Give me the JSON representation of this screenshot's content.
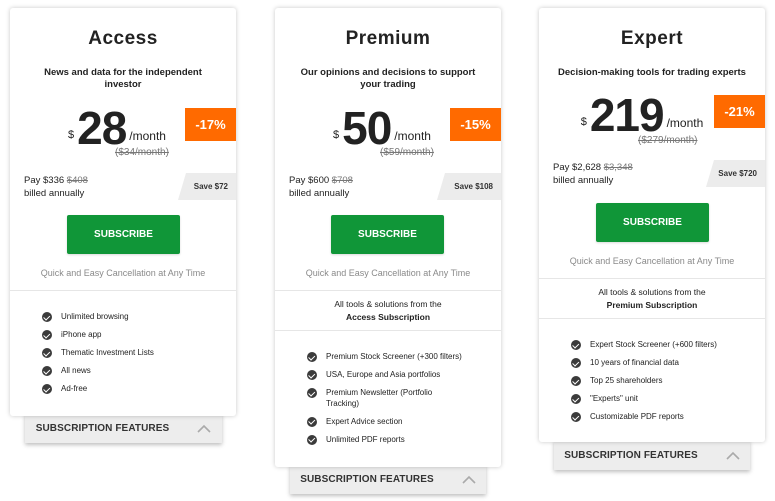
{
  "plans": [
    {
      "title": "Access",
      "description": "News and data for the independent investor",
      "currency": "$",
      "price": "28",
      "per": "/month",
      "old_price": "($34/month)",
      "discount": "-17%",
      "pay_prefix": "Pay $336",
      "pay_old": "$408",
      "billed": "billed annually",
      "save": "Save $72",
      "button": "SUBSCRIBE",
      "cancellation": "Quick and Easy Cancellation at Any Time",
      "features": [
        "Unlimited browsing",
        "iPhone app",
        "Thematic Investment Lists",
        "All news",
        "Ad-free"
      ],
      "tab": "SUBSCRIPTION FEATURES"
    },
    {
      "title": "Premium",
      "description": "Our opinions and decisions to support your trading",
      "currency": "$",
      "price": "50",
      "per": "/month",
      "old_price": "($59/month)",
      "discount": "-15%",
      "pay_prefix": "Pay $600",
      "pay_old": "$708",
      "billed": "billed annually",
      "save": "Save $108",
      "button": "SUBSCRIBE",
      "cancellation": "Quick and Easy Cancellation at Any Time",
      "note_line1": "All tools & solutions from the",
      "note_line2": "Access Subscription",
      "features": [
        "Premium Stock Screener (+300 filters)",
        "USA, Europe and Asia portfolios",
        "Premium Newsletter (Portfolio Tracking)",
        "Expert Advice section",
        "Unlimited PDF reports"
      ],
      "tab": "SUBSCRIPTION FEATURES"
    },
    {
      "title": "Expert",
      "description": "Decision-making tools for trading experts",
      "currency": "$",
      "price": "219",
      "per": "/month",
      "old_price": "($279/month)",
      "discount": "-21%",
      "pay_prefix": "Pay $2,628",
      "pay_old": "$3,348",
      "billed": "billed annually",
      "save": "Save $720",
      "button": "SUBSCRIBE",
      "cancellation": "Quick and Easy Cancellation at Any Time",
      "note_line1": "All tools & solutions from the",
      "note_line2": "Premium Subscription",
      "features": [
        "Expert Stock Screener (+600 filters)",
        "10 years of financial data",
        "Top 25 shareholders",
        "\"Experts\" unit",
        "Customizable PDF reports"
      ],
      "tab": "SUBSCRIPTION FEATURES"
    }
  ],
  "colors": {
    "accent_green": "#109638",
    "discount_orange": "#ff6a00",
    "tab_gray": "#ededed"
  },
  "icons": {
    "feature_bullet": "check-circle-icon",
    "tab_toggle": "chevron-up-icon"
  }
}
